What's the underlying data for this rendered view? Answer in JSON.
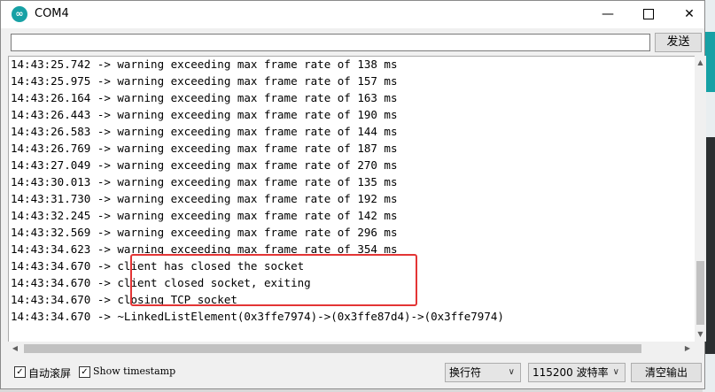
{
  "window": {
    "title": "COM4",
    "icon_symbol": "∞",
    "minimize_symbol": "—",
    "close_symbol": "✕"
  },
  "send": {
    "input_value": "",
    "button_label": "发送"
  },
  "output": {
    "lines": [
      "14:43:25.742 -> warning exceeding max frame rate of 138 ms",
      "14:43:25.975 -> warning exceeding max frame rate of 157 ms",
      "14:43:26.164 -> warning exceeding max frame rate of 163 ms",
      "14:43:26.443 -> warning exceeding max frame rate of 190 ms",
      "14:43:26.583 -> warning exceeding max frame rate of 144 ms",
      "14:43:26.769 -> warning exceeding max frame rate of 187 ms",
      "14:43:27.049 -> warning exceeding max frame rate of 270 ms",
      "14:43:30.013 -> warning exceeding max frame rate of 135 ms",
      "14:43:31.730 -> warning exceeding max frame rate of 192 ms",
      "14:43:32.245 -> warning exceeding max frame rate of 142 ms",
      "14:43:32.569 -> warning exceeding max frame rate of 296 ms",
      "14:43:34.623 -> warning exceeding max frame rate of 354 ms",
      "14:43:34.670 -> client has closed the socket",
      "14:43:34.670 -> client closed socket, exiting",
      "14:43:34.670 -> closing TCP socket",
      "14:43:34.670 -> ~LinkedListElement(0x3ffe7974)->(0x3ffe87d4)->(0x3ffe7974)"
    ]
  },
  "status": {
    "autoscroll_label": "自动滚屏",
    "autoscroll_checked": true,
    "timestamp_label": "Show timestamp",
    "timestamp_checked": true,
    "line_ending": "换行符",
    "baud_rate": "115200 波特率",
    "clear_label": "清空输出"
  },
  "colors": {
    "accent": "#17a1a5",
    "highlight_border": "#e33535"
  }
}
